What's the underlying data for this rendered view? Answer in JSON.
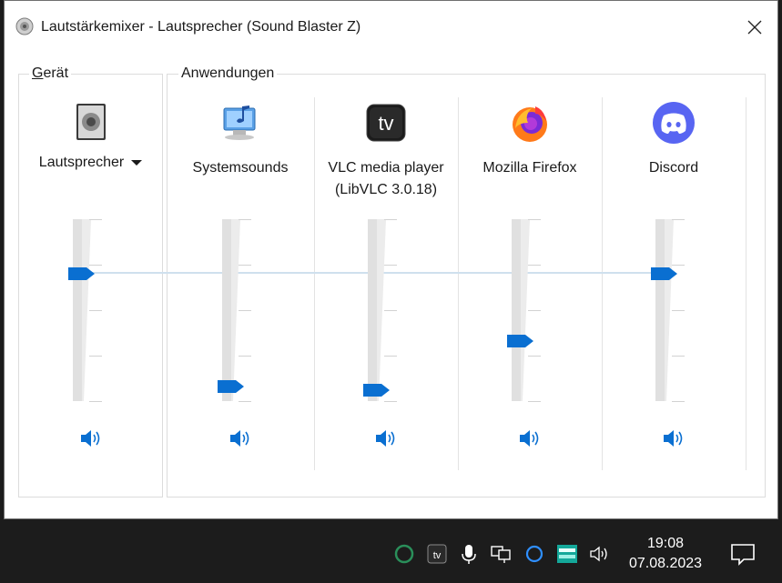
{
  "window": {
    "title": "Lautstärkemixer - Lautsprecher (Sound Blaster Z)"
  },
  "groups": {
    "device_label_accel": "G",
    "device_label_rest": "erät",
    "apps_label": "Anwendungen"
  },
  "device": {
    "name": "Lautsprecher",
    "volume_percent": 70
  },
  "apps": [
    {
      "name": "Systemsounds",
      "icon": "system-sounds-icon",
      "volume_percent": 8
    },
    {
      "name": "VLC media player (LibVLC 3.0.18)",
      "icon": "vlc-icon",
      "volume_percent": 6
    },
    {
      "name": "Mozilla Firefox",
      "icon": "firefox-icon",
      "volume_percent": 33
    },
    {
      "name": "Discord",
      "icon": "discord-icon",
      "volume_percent": 70
    }
  ],
  "taskbar": {
    "time": "19:08",
    "date": "07.08.2023",
    "tray_icons": [
      "circle-app-icon",
      "teamviewer-icon",
      "microphone-icon",
      "network-icon",
      "cortana-icon",
      "sound-blaster-icon",
      "volume-icon"
    ]
  },
  "colors": {
    "accent": "#0a6fd1",
    "track": "#e6e6e6",
    "discord": "#5865f2"
  }
}
